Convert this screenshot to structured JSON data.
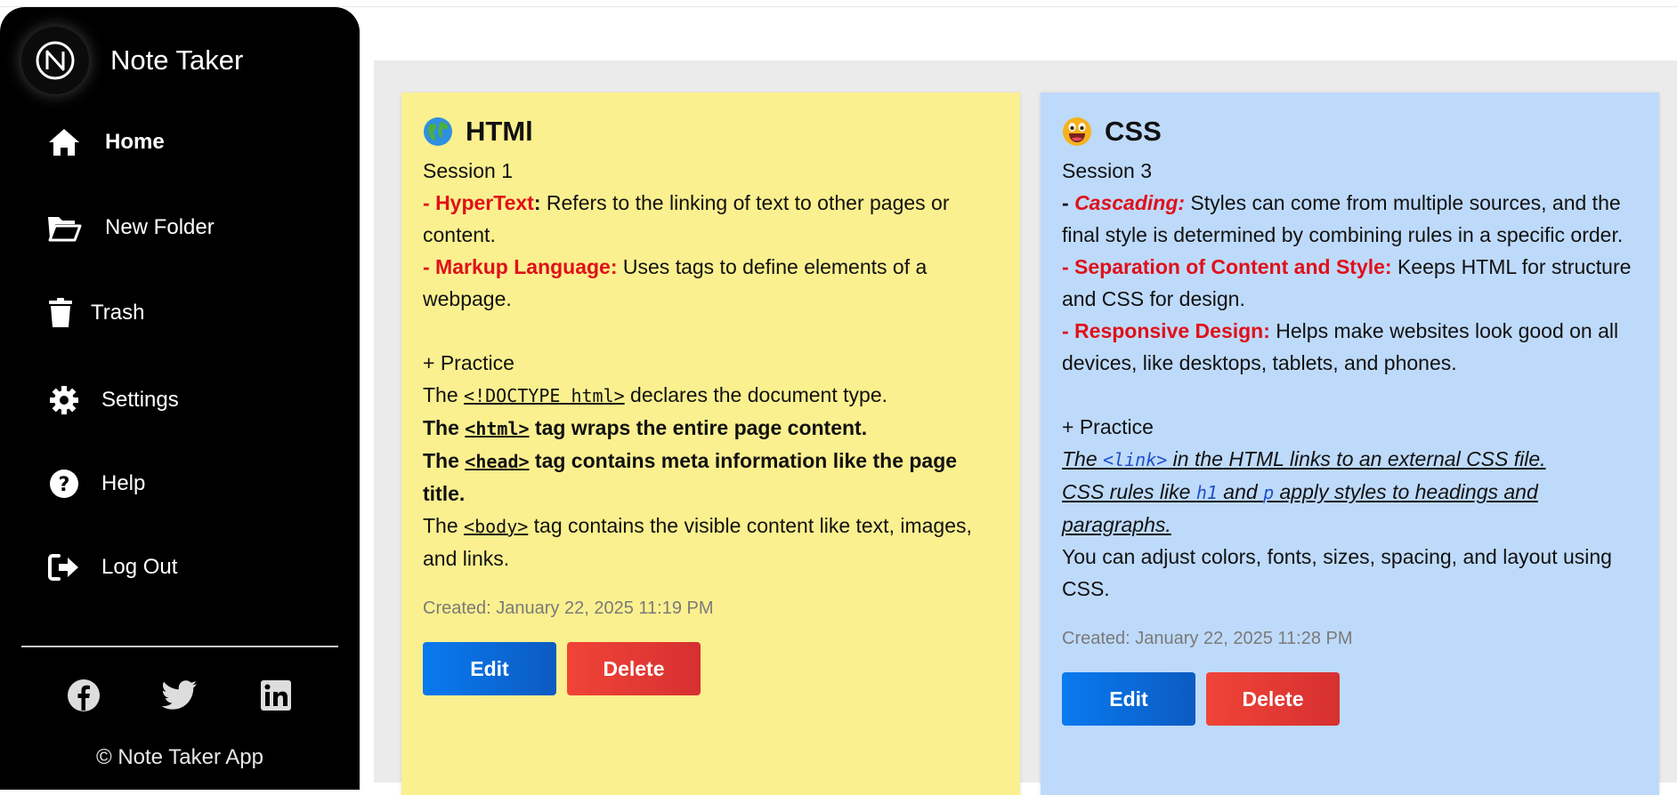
{
  "app": {
    "title": "Note Taker"
  },
  "nav": [
    {
      "label": "Home",
      "icon": "home-icon",
      "active": true
    },
    {
      "label": "New Folder",
      "icon": "folder-open-icon"
    },
    {
      "label": "Trash",
      "icon": "trash-icon"
    },
    {
      "label": "Settings",
      "icon": "gear-icon"
    },
    {
      "label": "Help",
      "icon": "help-circle-icon"
    },
    {
      "label": "Log Out",
      "icon": "logout-icon"
    }
  ],
  "socials": [
    "facebook-icon",
    "twitter-icon",
    "linkedin-icon"
  ],
  "footer": {
    "copyright": "© Note Taker App"
  },
  "notes": [
    {
      "color": "#fbf08f",
      "emoji": "globe-icon",
      "title": "HTMl",
      "session": "Session 1",
      "l1_prefix": "- ",
      "l1_term": "HyperText",
      "l1_colon": ":",
      "l1_text": " Refers to the linking of text to other pages or content.",
      "l2_term": "- Markup Language:",
      "l2_text": " Uses tags to define elements of a webpage.",
      "practice": "+ Practice",
      "p1_a": "The ",
      "p1_code": "<!DOCTYPE html>",
      "p1_b": " declares the document type.",
      "p2_a": "The ",
      "p2_code": "<html>",
      "p2_b": " tag wraps the entire page content.",
      "p3_a": "The ",
      "p3_code": "<head>",
      "p3_b": " tag contains meta information like the page title.",
      "p4_a": "The ",
      "p4_code": "<body>",
      "p4_b": " tag contains the visible content like text, images, and links.",
      "created": "Created: January 22, 2025 11:19 PM",
      "edit": "Edit",
      "delete": "Delete"
    },
    {
      "color": "#bedafa",
      "emoji": "grinning-face-icon",
      "title": "CSS",
      "session": "Session 3",
      "l1_prefix": "- ",
      "l1_term": "Cascading:",
      "l1_text": " Styles can come from multiple sources, and the final style is determined by combining rules in a specific order.",
      "l2_term": "- Separation of Content and Style:",
      "l2_text": " Keeps HTML for structure and CSS for design.",
      "l3_term": "- Responsive Design:",
      "l3_text": " Helps make websites look good on all devices, like desktops, tablets, and phones.",
      "practice": "+ Practice",
      "p1_a": "The ",
      "p1_code": "<link>",
      "p1_b": " in the HTML links to an external CSS file.",
      "p2_a": "CSS rules like ",
      "p2_code1": "h1",
      "p2_mid": " and ",
      "p2_code2": "p",
      "p2_b": " apply styles to headings and paragraphs.",
      "p3": "You can adjust colors, fonts, sizes, spacing, and layout using CSS.",
      "created": "Created: January 22, 2025 11:28 PM",
      "edit": "Edit",
      "delete": "Delete"
    }
  ]
}
